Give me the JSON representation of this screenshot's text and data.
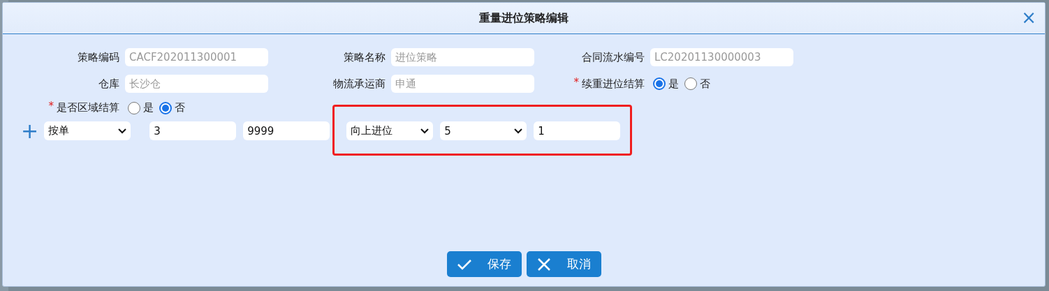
{
  "dialog": {
    "title": "重量进位策略编辑",
    "close": "×"
  },
  "fields": [
    {
      "kind": "text",
      "label": "策略编码",
      "value": "CACF202011300001",
      "disabled": true
    },
    {
      "kind": "text",
      "label": "策略名称",
      "value": "进位策略",
      "disabled": true
    },
    {
      "kind": "text",
      "label": "合同流水编号",
      "value": "LC20201130000003",
      "disabled": true
    },
    {
      "kind": "text",
      "label": "仓库",
      "value": "长沙仓",
      "disabled": true
    },
    {
      "kind": "text",
      "label": "物流承运商",
      "value": "申通",
      "disabled": true
    },
    {
      "kind": "radio",
      "label": "续重进位结算",
      "required_mark": "*",
      "options": [
        {
          "label": "是",
          "selected": true
        },
        {
          "label": "否",
          "selected": false
        }
      ]
    },
    {
      "kind": "radio",
      "label": "是否区域结算",
      "required_mark": "*",
      "options": [
        {
          "label": "是",
          "selected": false
        },
        {
          "label": "否",
          "selected": true
        }
      ]
    }
  ],
  "rule_row": {
    "add": "+",
    "controls": [
      {
        "kind": "select",
        "value": "按单"
      },
      {
        "kind": "input",
        "value": "3"
      },
      {
        "kind": "input",
        "value": "9999"
      }
    ],
    "highlight_box": {
      "controls": [
        {
          "kind": "select",
          "value": "向上进位"
        },
        {
          "kind": "select",
          "value": "5"
        },
        {
          "kind": "input",
          "value": "1"
        }
      ]
    }
  },
  "buttons": [
    {
      "kind": "save",
      "label": "保存"
    },
    {
      "kind": "cancel",
      "label": "取消"
    }
  ]
}
